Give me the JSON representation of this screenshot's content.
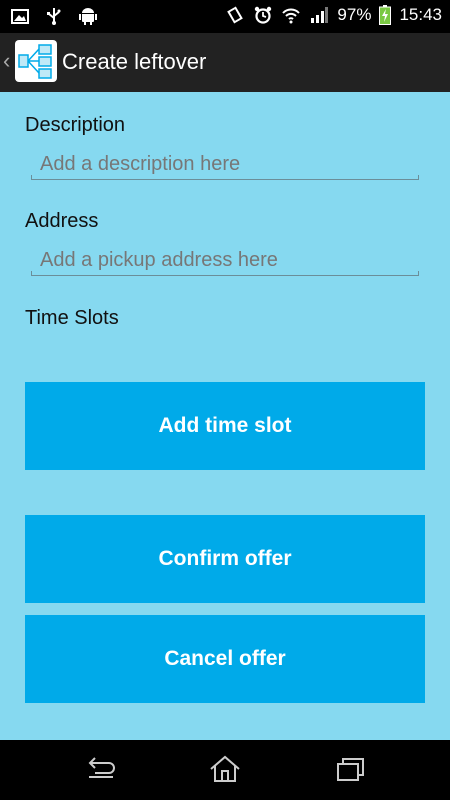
{
  "status_bar": {
    "battery_percent": "97%",
    "time": "15:43",
    "icons": [
      "gallery-icon",
      "usb-icon",
      "android-icon",
      "vibrate-icon",
      "alarm-icon",
      "wifi-icon",
      "signal-icon",
      "battery-icon"
    ]
  },
  "action_bar": {
    "title": "Create leftover"
  },
  "form": {
    "description_label": "Description",
    "description_placeholder": "Add a description here",
    "address_label": "Address",
    "address_placeholder": "Add a pickup address here",
    "time_slots_label": "Time Slots"
  },
  "buttons": {
    "add_time_slot": "Add time slot",
    "confirm_offer": "Confirm offer",
    "cancel_offer": "Cancel offer"
  },
  "nav_bar": {
    "icons": [
      "back-icon",
      "home-icon",
      "recents-icon"
    ]
  },
  "colors": {
    "background": "#86d9f0",
    "button": "#00aae9",
    "action_bar": "#222222"
  }
}
